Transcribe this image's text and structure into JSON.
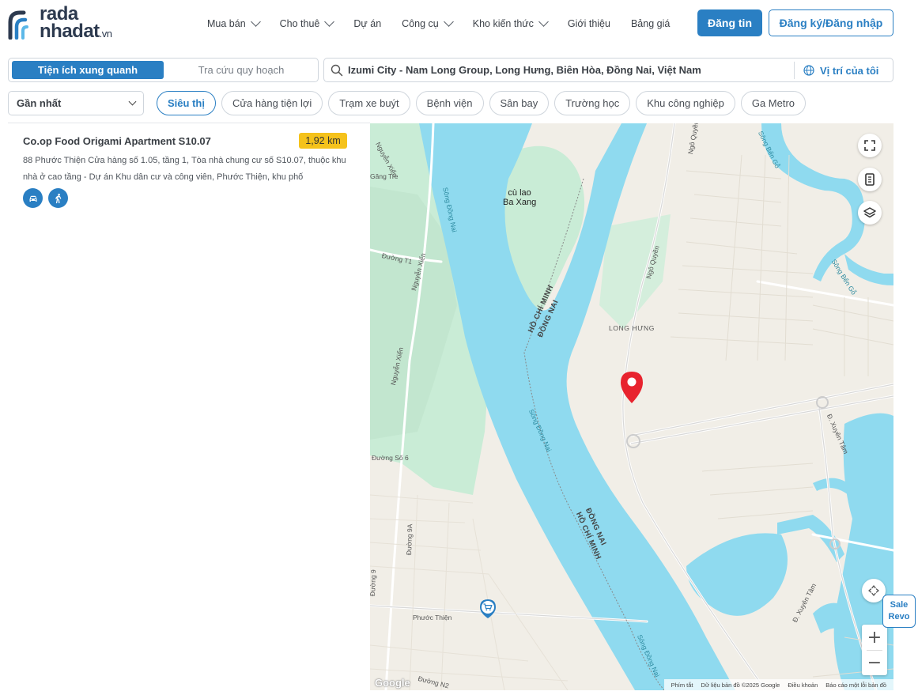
{
  "header": {
    "logo_line1": "rada",
    "logo_line2": "nhadat",
    "logo_suffix": ".vn",
    "nav": [
      {
        "label": "Mua bán",
        "has_dropdown": true
      },
      {
        "label": "Cho thuê",
        "has_dropdown": true
      },
      {
        "label": "Dự án",
        "has_dropdown": false
      },
      {
        "label": "Công cụ",
        "has_dropdown": true
      },
      {
        "label": "Kho kiến thức",
        "has_dropdown": true
      },
      {
        "label": "Giới thiệu",
        "has_dropdown": false
      },
      {
        "label": "Bảng giá",
        "has_dropdown": false
      }
    ],
    "post_button": "Đăng tin",
    "login_button": "Đăng ký/Đăng nhập"
  },
  "toolbar": {
    "mode_active": "Tiện ích xung quanh",
    "mode_other": "Tra cứu quy hoạch",
    "search_value": "Izumi City - Nam Long Group, Long Hưng, Biên Hòa, Đồng Nai, Việt Nam",
    "locate_label": "Vị trí của tôi",
    "sort_value": "Gần nhất",
    "categories": [
      "Siêu thị",
      "Cửa hàng tiện lợi",
      "Trạm xe buýt",
      "Bệnh viện",
      "Sân bay",
      "Trường học",
      "Khu công nghiệp",
      "Ga Metro"
    ],
    "active_category": "Siêu thị"
  },
  "results": [
    {
      "name": "Co.op Food Origami Apartment S10.07",
      "distance": "1,92 km",
      "address": "88 Phước Thiện Cửa hàng số 1.05, tầng 1, Tòa nhà chung cư số S10.07, thuộc khu nhà ở cao tầng - Dự án Khu dân cư và công viên, Phước Thiện, khu phố",
      "transport_icons": [
        "car-icon",
        "walk-icon"
      ]
    }
  ],
  "map": {
    "labels": {
      "song_dong_nai_1": "Sông Đồng Nai",
      "song_dong_nai_2": "Sông Đồng Nai",
      "song_dong_nai_3": "Sông Đồng Nai",
      "song_ben_go_1": "Sông Bến Gỗ",
      "song_ben_go_2": "Sông Bến Gỗ",
      "cu_lao": "cù lao\nBa Xang",
      "hcm_1": "HỒ CHÍ MINH",
      "dong_nai_1": "ĐỒNG NAI",
      "dong_nai_2": "ĐỒNG NAI",
      "hcm_2": "HỒ CHÍ MINH",
      "long_hung": "LONG HƯNG",
      "ngo_quyen_1": "Ngô Quyền",
      "ngo_quyen_2": "Ngô Quyền",
      "nguyen_xien_1": "Nguyễn Xiển",
      "nguyen_xien_2": "Nguyễn Xiển",
      "nguyen_xien_3": "Nguyễn Xiển",
      "duong_t1": "Đường T1",
      "gang_tre": "Găng Tre",
      "duong_so_6": "Đường Số 6",
      "duong_9a": "Đường 9A",
      "duong_9": "Đường 9",
      "phuoc_thien": "Phước Thiện",
      "duong_n2": "Đường N2",
      "xuyen_tam_1": "Đ. Xuyên Tâm",
      "xuyen_tam_2": "Đ. Xuyên Tâm"
    },
    "attribution": [
      "Phím tắt",
      "Dữ liệu bản đồ ©2025 Google",
      "Điều khoản",
      "Báo cáo một lỗi bản đồ"
    ],
    "google": "Google",
    "zoom_in": "+",
    "zoom_out": "−",
    "colors": {
      "water": "#8fdaef",
      "green": "#c9ecd6",
      "land": "#f1eee7",
      "road": "#ffffff",
      "marker": "#e8232e",
      "accent": "#2a7fc3"
    }
  },
  "sale_badge": {
    "line1": "Sale",
    "line2": "Revo"
  }
}
